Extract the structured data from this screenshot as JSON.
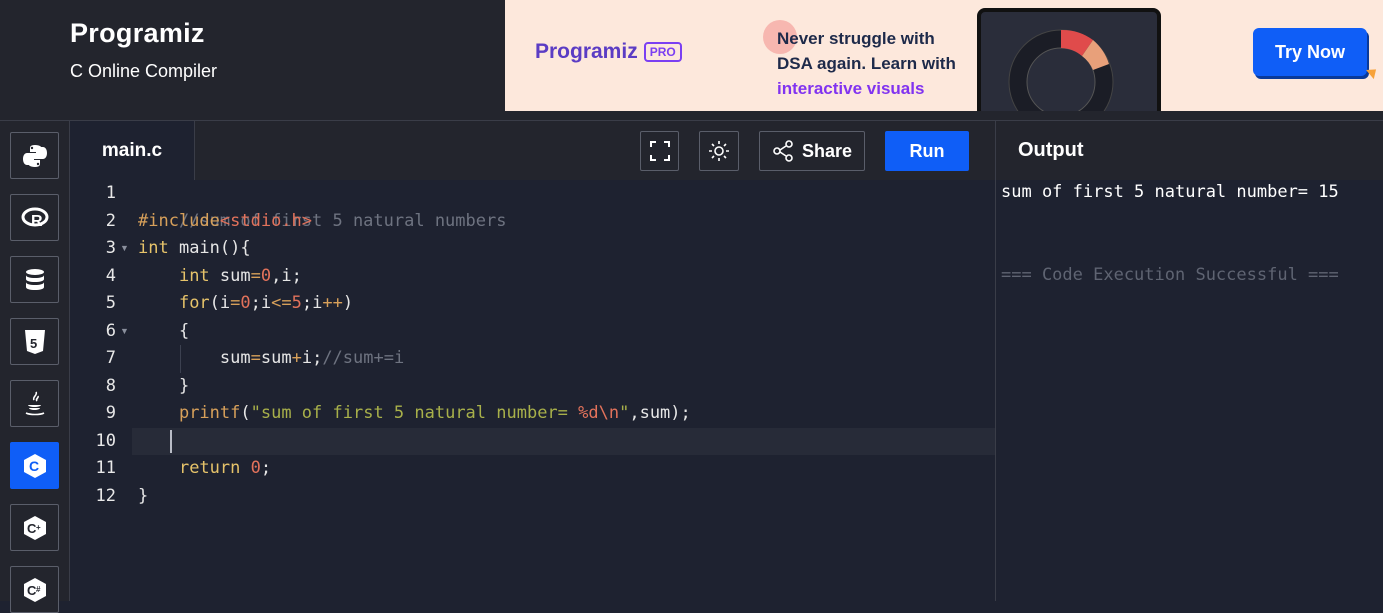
{
  "header": {
    "brand": "Programiz",
    "subtitle": "C Online Compiler"
  },
  "ad": {
    "logo_text": "Programiz",
    "logo_badge": "PRO",
    "line1": "Never struggle with",
    "line2": "DSA again. Learn with",
    "line3": "interactive visuals",
    "cta": "Try Now"
  },
  "sidebar": {
    "languages": [
      {
        "name": "python",
        "icon": "python-icon"
      },
      {
        "name": "r",
        "icon": "r-icon"
      },
      {
        "name": "sql",
        "icon": "database-icon"
      },
      {
        "name": "html",
        "icon": "html5-icon"
      },
      {
        "name": "java",
        "icon": "java-icon"
      },
      {
        "name": "c",
        "icon": "c-icon",
        "active": true
      },
      {
        "name": "cpp",
        "icon": "cpp-icon"
      },
      {
        "name": "csharp",
        "icon": "csharp-icon"
      }
    ]
  },
  "editor": {
    "file_name": "main.c",
    "toolbar": {
      "share_label": "Share",
      "run_label": "Run"
    },
    "line_numbers": [
      "1",
      "2",
      "3",
      "4",
      "5",
      "6",
      "7",
      "8",
      "9",
      "10",
      "11",
      "12"
    ],
    "code": {
      "l1": "//sum of first 5 natural numbers",
      "l2_pre": "#include",
      "l2_inc": "<stdio.h>",
      "l3_kw": "int",
      "l3_rest": " main(){",
      "l4_kw": "int",
      "l4_a": " sum",
      "l4_op": "=",
      "l4_num": "0",
      "l4_b": ",i;",
      "l5_kw": "for",
      "l5_a": "(i",
      "l5_op1": "=",
      "l5_num1": "0",
      "l5_b": ";i",
      "l5_op2": "<=",
      "l5_num2": "5",
      "l5_c": ";i",
      "l5_op3": "++",
      "l5_d": ")",
      "l6": "{",
      "l7_a": "sum",
      "l7_op1": "=",
      "l7_b": "sum",
      "l7_op2": "+",
      "l7_c": "i;",
      "l7_com": "//sum+=i",
      "l8": "}",
      "l9_fn": "printf",
      "l9_a": "(",
      "l9_str1": "\"sum of first 5 natural number= ",
      "l9_esc": "%d\\n",
      "l9_str2": "\"",
      "l9_b": ",sum);",
      "l11_kw": "return",
      "l11_num": "0",
      "l11_b": ";",
      "l12": "}"
    }
  },
  "output": {
    "title": "Output",
    "result": "sum of first 5 natural number= 15",
    "status": "=== Code Execution Successful ==="
  },
  "colors": {
    "accent": "#0f5ef7",
    "background": "#1e2230",
    "panel": "#23252d"
  }
}
